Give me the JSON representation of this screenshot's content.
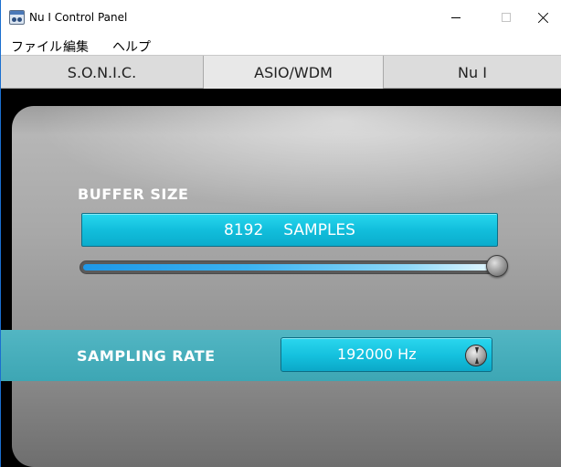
{
  "window": {
    "title": "Nu I Control Panel",
    "app_icon": "mixer-icon"
  },
  "menu": {
    "items": [
      "ファイル",
      "編集",
      "ヘルプ"
    ]
  },
  "tabs": [
    {
      "label": "S.O.N.I.C.",
      "selected": false
    },
    {
      "label": "ASIO/WDM",
      "selected": true
    },
    {
      "label": "Nu I",
      "selected": false
    }
  ],
  "buffer": {
    "label": "BUFFER SIZE",
    "value": "8192",
    "unit": "SAMPLES",
    "slider_level": 1.0
  },
  "sampling": {
    "label": "SAMPLING RATE",
    "value": "192000 Hz",
    "dial_icon": "dial-icon"
  },
  "colors": {
    "accent_cyan": "#14c0dd",
    "band_teal": "#45adbb",
    "panel_gray": "#a8a8a8"
  }
}
